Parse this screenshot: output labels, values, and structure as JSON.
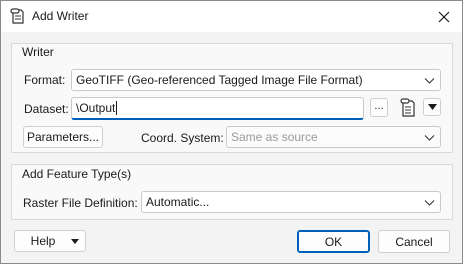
{
  "window": {
    "title": "Add Writer",
    "icon": "writer-document-icon",
    "close_icon": "close-icon"
  },
  "writer_group": {
    "title": "Writer",
    "format_label": "Format:",
    "format_value": "GeoTIFF (Geo-referenced Tagged Image File Format)",
    "dataset_label": "Dataset:",
    "dataset_value": "\\Output",
    "browse_label": "...",
    "parameters_label": "Parameters...",
    "coord_label": "Coord. System:",
    "coord_value": "Same as source"
  },
  "feature_group": {
    "title": "Add Feature Type(s)",
    "raster_label": "Raster File Definition:",
    "raster_value": "Automatic..."
  },
  "footer": {
    "help_label": "Help",
    "ok_label": "OK",
    "cancel_label": "Cancel"
  },
  "colors": {
    "accent": "#005fb8",
    "window_bg": "#f3f3f3"
  }
}
